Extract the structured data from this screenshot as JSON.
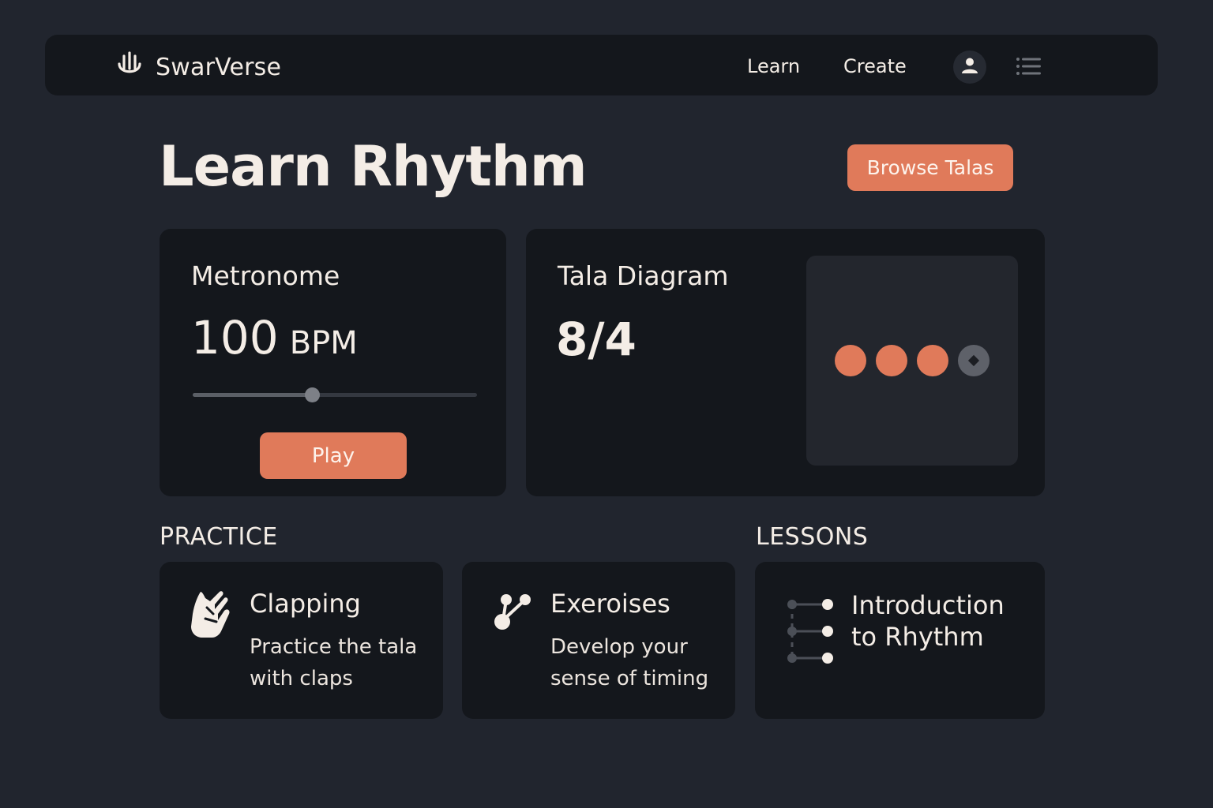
{
  "app": {
    "name": "SwarVerse",
    "logo_icon": "hand-icon"
  },
  "nav": {
    "links": [
      {
        "label": "Learn"
      },
      {
        "label": "Create"
      }
    ],
    "avatar_icon": "user-icon",
    "menu_icon": "menu-icon"
  },
  "page": {
    "title": "Learn Rhythm",
    "browse_label": "Browse Talas"
  },
  "metronome": {
    "title": "Metronome",
    "bpm_value": "100",
    "bpm_unit": "BPM",
    "slider_level": 0.42,
    "play_label": "Play"
  },
  "tala": {
    "title": "Tala Diagram",
    "signature": "8/4",
    "beats": [
      "tali",
      "tali",
      "tali",
      "khali"
    ]
  },
  "colors": {
    "accent": "#e07a5a",
    "background": "#21252e",
    "card": "#14171c",
    "text": "#f4ede6"
  },
  "practice": {
    "label": "PRACTICE",
    "items": [
      {
        "title": "Clapping",
        "desc_line1": "Practice the tala",
        "desc_line2": "with claps",
        "icon": "clapping-hand-icon"
      },
      {
        "title": "Exeroises",
        "desc_line1": "Develop your",
        "desc_line2": "sense of timing",
        "icon": "nodes-icon"
      }
    ]
  },
  "lessons": {
    "label": "LESSONS",
    "items": [
      {
        "title_line1": "Introduction",
        "title_line2": "to Rhythm",
        "icon": "steps-icon"
      }
    ]
  }
}
